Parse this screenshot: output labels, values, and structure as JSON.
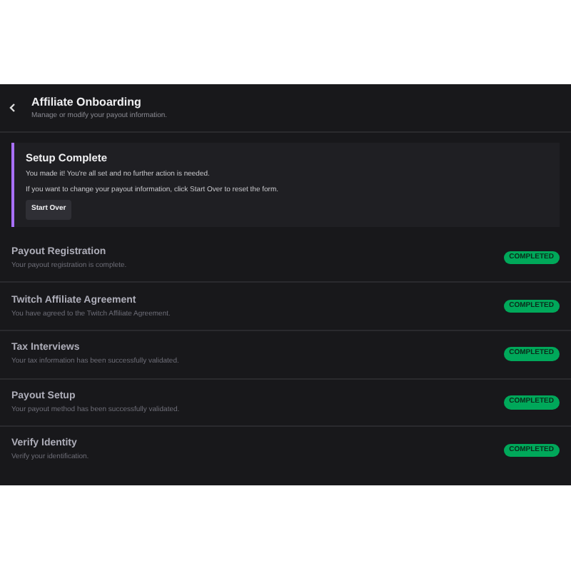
{
  "header": {
    "title": "Affiliate Onboarding",
    "subtitle": "Manage or modify your payout information."
  },
  "notice": {
    "title": "Setup Complete",
    "lines": [
      "You made it! You're all set and no further action is needed.",
      "If you want to change your payout information, click Start Over to reset the form."
    ],
    "button": "Start Over"
  },
  "steps": [
    {
      "title": "Payout Registration",
      "description": "Your payout registration is complete.",
      "status": "COMPLETED"
    },
    {
      "title": "Twitch Affiliate Agreement",
      "description": "You have agreed to the Twitch Affiliate Agreement.",
      "status": "COMPLETED"
    },
    {
      "title": "Tax Interviews",
      "description": "Your tax information has been successfully validated.",
      "status": "COMPLETED"
    },
    {
      "title": "Payout Setup",
      "description": "Your payout method has been successfully validated.",
      "status": "COMPLETED"
    },
    {
      "title": "Verify Identity",
      "description": "Verify your identification.",
      "status": "COMPLETED"
    }
  ]
}
